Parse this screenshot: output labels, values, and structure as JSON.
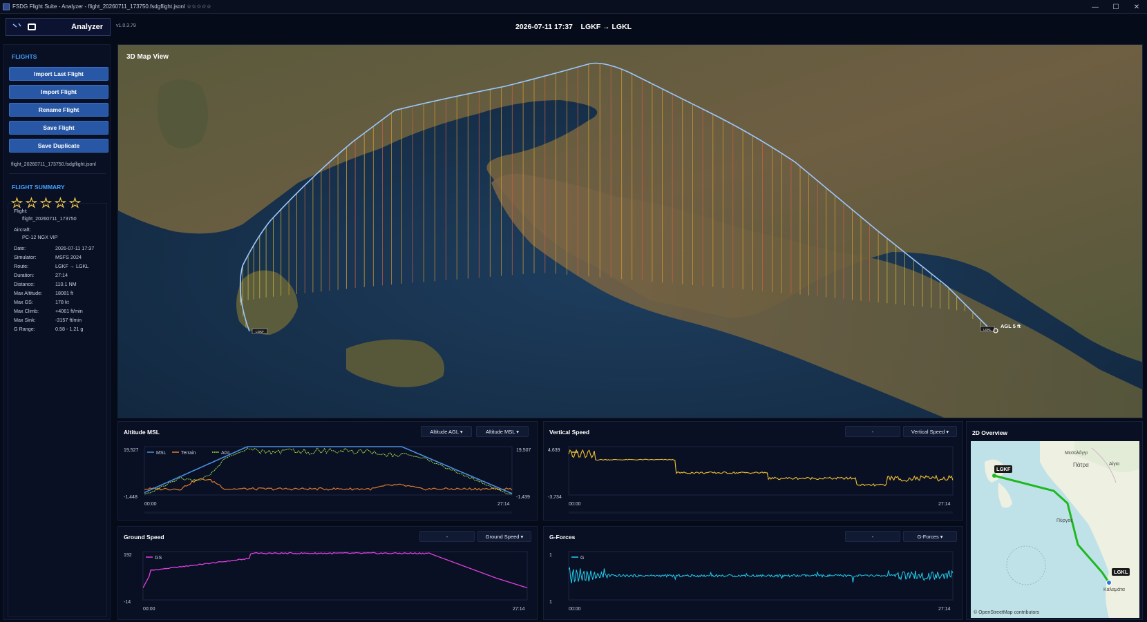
{
  "window": {
    "title": "FSDG Flight Suite - Analyzer - flight_20260711_173750.fsdgflight.jsonl ☆☆☆☆☆",
    "minimize": "—",
    "maximize": "☐",
    "close": "✕"
  },
  "header": {
    "app_name": "Analyzer",
    "version": "v1.0.3.79",
    "title": "2026-07-11 17:37    LGKF → LGKL"
  },
  "sidebar": {
    "flights_heading": "FLIGHTS",
    "buttons": [
      "Import Last Flight",
      "Import Flight",
      "Rename Flight",
      "Save Flight",
      "Save Duplicate"
    ],
    "current_file": "flight_20260711_173750.fsdgflight.jsonl",
    "summary_heading": "FLIGHT SUMMARY",
    "rating": 0,
    "rating_max": 5,
    "summary": {
      "flight_label": "Flight:",
      "flight_value": "flight_20260711_173750",
      "aircraft_label": "Aircraft:",
      "aircraft_value": "PC-12 NGX VIP",
      "rows": [
        {
          "k": "Date:",
          "v": "2026-07-11 17:37"
        },
        {
          "k": "Simulator:",
          "v": "MSFS 2024"
        },
        {
          "k": "Route:",
          "v": "LGKF → LGKL"
        },
        {
          "k": "Duration:",
          "v": "27:14"
        },
        {
          "k": "Distance:",
          "v": "110.1 NM"
        },
        {
          "k": "Max Altitude:",
          "v": "18081 ft"
        },
        {
          "k": "Max GS:",
          "v": "178 kt"
        },
        {
          "k": "Max Climb:",
          "v": "+4061 ft/min"
        },
        {
          "k": "Max Sink:",
          "v": "-3157 ft/min"
        },
        {
          "k": "G Range:",
          "v": "0.58 - 1.21 g"
        }
      ]
    }
  },
  "map3d": {
    "title": "3D Map View",
    "start_marker": "LGKF",
    "end_marker": "LGKL",
    "agl_label": "AGL 5 ft"
  },
  "panels": {
    "altitude": {
      "title": "Altitude MSL",
      "dropdown1": "Altitude AGL ▾",
      "dropdown2": "Altitude MSL ▾",
      "y_top_left": "19,527",
      "y_bottom_left": "-1,448",
      "y_top_right": "19,507",
      "y_bottom_right": "-1,439",
      "x_start": "00:00",
      "x_end": "27:14",
      "legend": [
        "MSL",
        "Terrain",
        "AGL"
      ]
    },
    "vspeed": {
      "title": "Vertical Speed",
      "dropdown1": "-",
      "dropdown2": "Vertical Speed ▾",
      "y_top": "4,639",
      "y_bottom": "-3,734",
      "x_start": "00:00",
      "x_end": "27:14",
      "legend": [
        "VS"
      ]
    },
    "gspeed": {
      "title": "Ground Speed",
      "dropdown1": "-",
      "dropdown2": "Ground Speed ▾",
      "y_top": "192",
      "y_bottom": "-14",
      "x_start": "00:00",
      "x_end": "27:14",
      "legend": [
        "GS"
      ]
    },
    "gforces": {
      "title": "G-Forces",
      "dropdown1": "-",
      "dropdown2": "G-Forces ▾",
      "y_top": "1",
      "y_bottom": "1",
      "x_start": "00:00",
      "x_end": "27:14",
      "legend": [
        "G"
      ]
    }
  },
  "overview": {
    "title": "2D Overview",
    "start_label": "LGKF",
    "end_label": "LGKL",
    "credit": "© OpenStreetMap contributors",
    "towns": [
      "Πάτρα",
      "Μεσολόγγι",
      "Αίγιο",
      "Πύργος",
      "Καλαμάτα"
    ]
  },
  "colors": {
    "accent": "#3fa0ff",
    "button": "#2757a5",
    "msl": "#4a8fe0",
    "terrain": "#e07a2a",
    "agl": "#a4e04a",
    "vs": "#f0c030",
    "gs": "#e040e0",
    "g": "#20d0f0",
    "track": "#9cc8ff",
    "route_2d": "#1fb81f"
  }
}
